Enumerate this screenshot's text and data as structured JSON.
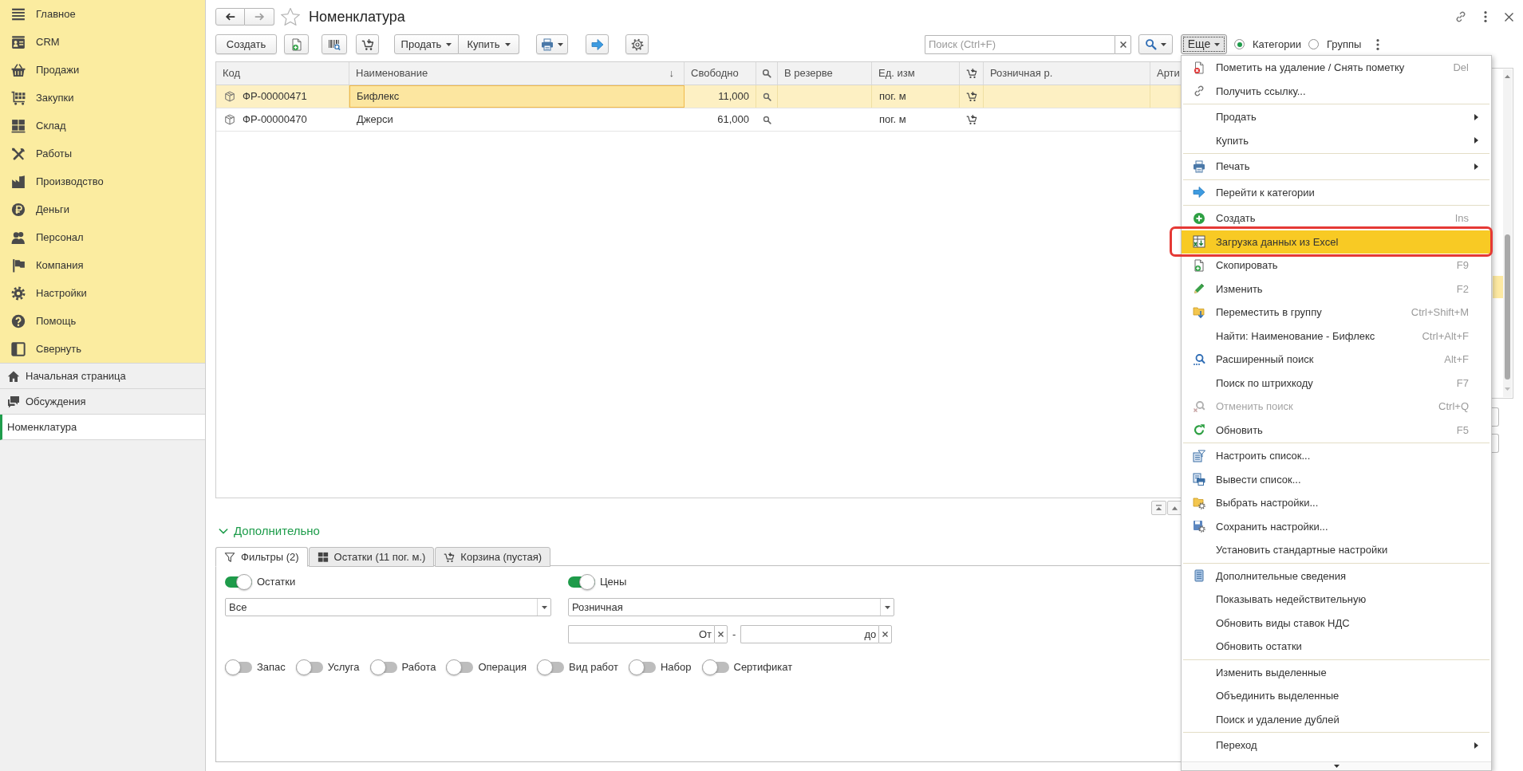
{
  "sidebar": {
    "sections": [
      {
        "label": "Главное"
      },
      {
        "label": "CRM"
      },
      {
        "label": "Продажи"
      },
      {
        "label": "Закупки"
      },
      {
        "label": "Склад"
      },
      {
        "label": "Работы"
      },
      {
        "label": "Производство"
      },
      {
        "label": "Деньги"
      },
      {
        "label": "Персонал"
      },
      {
        "label": "Компания"
      },
      {
        "label": "Настройки"
      },
      {
        "label": "Помощь"
      },
      {
        "label": "Свернуть"
      }
    ],
    "open_windows": [
      {
        "label": "Начальная страница",
        "selected": false
      },
      {
        "label": "Обсуждения",
        "selected": false
      },
      {
        "label": "Номенклатура",
        "selected": true
      }
    ]
  },
  "form": {
    "title": "Номенклатура",
    "favorite": false,
    "navigation": {
      "back": {
        "disabled": false
      },
      "forward": {
        "disabled": true
      }
    }
  },
  "toolbar": {
    "create": "Создать",
    "sell": "Продать",
    "buy": "Купить",
    "search": {
      "placeholder": "Поиск (Ctrl+F)"
    },
    "more": "Еще",
    "view_modes": [
      {
        "label": "Категории",
        "selected": true
      },
      {
        "label": "Группы",
        "selected": false
      }
    ]
  },
  "table": {
    "columns": [
      {
        "kind": "text",
        "label": "Код"
      },
      {
        "kind": "text",
        "label": "Наименование",
        "sort_mark": "↓"
      },
      {
        "kind": "text",
        "label": "Свободно"
      },
      {
        "kind": "lookup"
      },
      {
        "kind": "text",
        "label": "В резерве"
      },
      {
        "kind": "text",
        "label": "Ед. изм"
      },
      {
        "kind": "cart"
      },
      {
        "kind": "text",
        "label": "Розничная р."
      },
      {
        "kind": "text",
        "label": "Арти"
      }
    ],
    "rows": [
      {
        "selected": true,
        "code": "ФР-00000471",
        "name": "Бифлекс",
        "free": "11,000",
        "unit": "пог. м"
      },
      {
        "selected": false,
        "code": "ФР-00000470",
        "name": "Джерси",
        "free": "61,000",
        "unit": "пог. м"
      }
    ]
  },
  "additional": {
    "title": "Дополнительно",
    "expanded": true,
    "tabs": [
      {
        "label": "Фильтры (2)",
        "selected": true
      },
      {
        "label": "Остатки (11 пог. м.)",
        "selected": false
      },
      {
        "label": "Корзина (пустая)",
        "selected": false
      }
    ],
    "stock_filter": {
      "label": "Остатки",
      "on": true,
      "value": "Все"
    },
    "price_filter": {
      "label": "Цены",
      "on": true,
      "value": "Розничная",
      "from": {
        "placeholder": "От"
      },
      "dash": "-",
      "to": {
        "placeholder": "до"
      }
    },
    "type_filters": [
      {
        "label": "Запас",
        "on": false
      },
      {
        "label": "Услуга",
        "on": false
      },
      {
        "label": "Работа",
        "on": false
      },
      {
        "label": "Операция",
        "on": false
      },
      {
        "label": "Вид работ",
        "on": false
      },
      {
        "label": "Набор",
        "on": false
      },
      {
        "label": "Сертификат",
        "on": false
      }
    ]
  },
  "menu": {
    "groups": [
      [
        {
          "label": "Пометить на удаление / Снять пометку",
          "shortcut": "Del",
          "submenu": false,
          "disabled": false,
          "selected": false
        },
        {
          "label": "Получить ссылку...",
          "submenu": false,
          "disabled": false,
          "selected": false
        }
      ],
      [
        {
          "label": "Продать",
          "submenu": true,
          "disabled": false,
          "selected": false
        },
        {
          "label": "Купить",
          "submenu": true,
          "disabled": false,
          "selected": false
        }
      ],
      [
        {
          "label": "Печать",
          "submenu": true,
          "disabled": false,
          "selected": false
        }
      ],
      [
        {
          "label": "Перейти к категории",
          "submenu": false,
          "disabled": false,
          "selected": false
        }
      ],
      [
        {
          "label": "Создать",
          "shortcut": "Ins",
          "submenu": false,
          "disabled": false,
          "selected": false
        },
        {
          "label": "Загрузка данных из Excel",
          "submenu": false,
          "disabled": false,
          "selected": true
        },
        {
          "label": "Скопировать",
          "shortcut": "F9",
          "submenu": false,
          "disabled": false,
          "selected": false
        },
        {
          "label": "Изменить",
          "shortcut": "F2",
          "submenu": false,
          "disabled": false,
          "selected": false
        },
        {
          "label": "Переместить в группу",
          "shortcut": "Ctrl+Shift+M",
          "submenu": false,
          "disabled": false,
          "selected": false
        },
        {
          "label": "Найти: Наименование - Бифлекс",
          "shortcut": "Ctrl+Alt+F",
          "submenu": false,
          "disabled": false,
          "selected": false
        },
        {
          "label": "Расширенный поиск",
          "shortcut": "Alt+F",
          "submenu": false,
          "disabled": false,
          "selected": false
        },
        {
          "label": "Поиск по штрихкоду",
          "shortcut": "F7",
          "submenu": false,
          "disabled": false,
          "selected": false
        },
        {
          "label": "Отменить поиск",
          "shortcut": "Ctrl+Q",
          "submenu": false,
          "disabled": true,
          "selected": false
        },
        {
          "label": "Обновить",
          "shortcut": "F5",
          "submenu": false,
          "disabled": false,
          "selected": false
        }
      ],
      [
        {
          "label": "Настроить список...",
          "submenu": false,
          "disabled": false,
          "selected": false
        },
        {
          "label": "Вывести список...",
          "submenu": false,
          "disabled": false,
          "selected": false
        },
        {
          "label": "Выбрать настройки...",
          "submenu": false,
          "disabled": false,
          "selected": false
        },
        {
          "label": "Сохранить настройки...",
          "submenu": false,
          "disabled": false,
          "selected": false
        },
        {
          "label": "Установить стандартные настройки",
          "submenu": false,
          "disabled": false,
          "selected": false
        }
      ],
      [
        {
          "label": "Дополнительные сведения",
          "submenu": false,
          "disabled": false,
          "selected": false
        },
        {
          "label": "Показывать недействительную",
          "submenu": false,
          "disabled": false,
          "selected": false
        },
        {
          "label": "Обновить виды ставок НДС",
          "submenu": false,
          "disabled": false,
          "selected": false
        },
        {
          "label": "Обновить остатки",
          "submenu": false,
          "disabled": false,
          "selected": false
        }
      ],
      [
        {
          "label": "Изменить выделенные",
          "submenu": false,
          "disabled": false,
          "selected": false
        },
        {
          "label": "Объединить выделенные",
          "submenu": false,
          "disabled": false,
          "selected": false
        },
        {
          "label": "Поиск и удаление дублей",
          "submenu": false,
          "disabled": false,
          "selected": false
        }
      ],
      [
        {
          "label": "Переход",
          "submenu": true,
          "disabled": false,
          "selected": false
        }
      ]
    ]
  }
}
